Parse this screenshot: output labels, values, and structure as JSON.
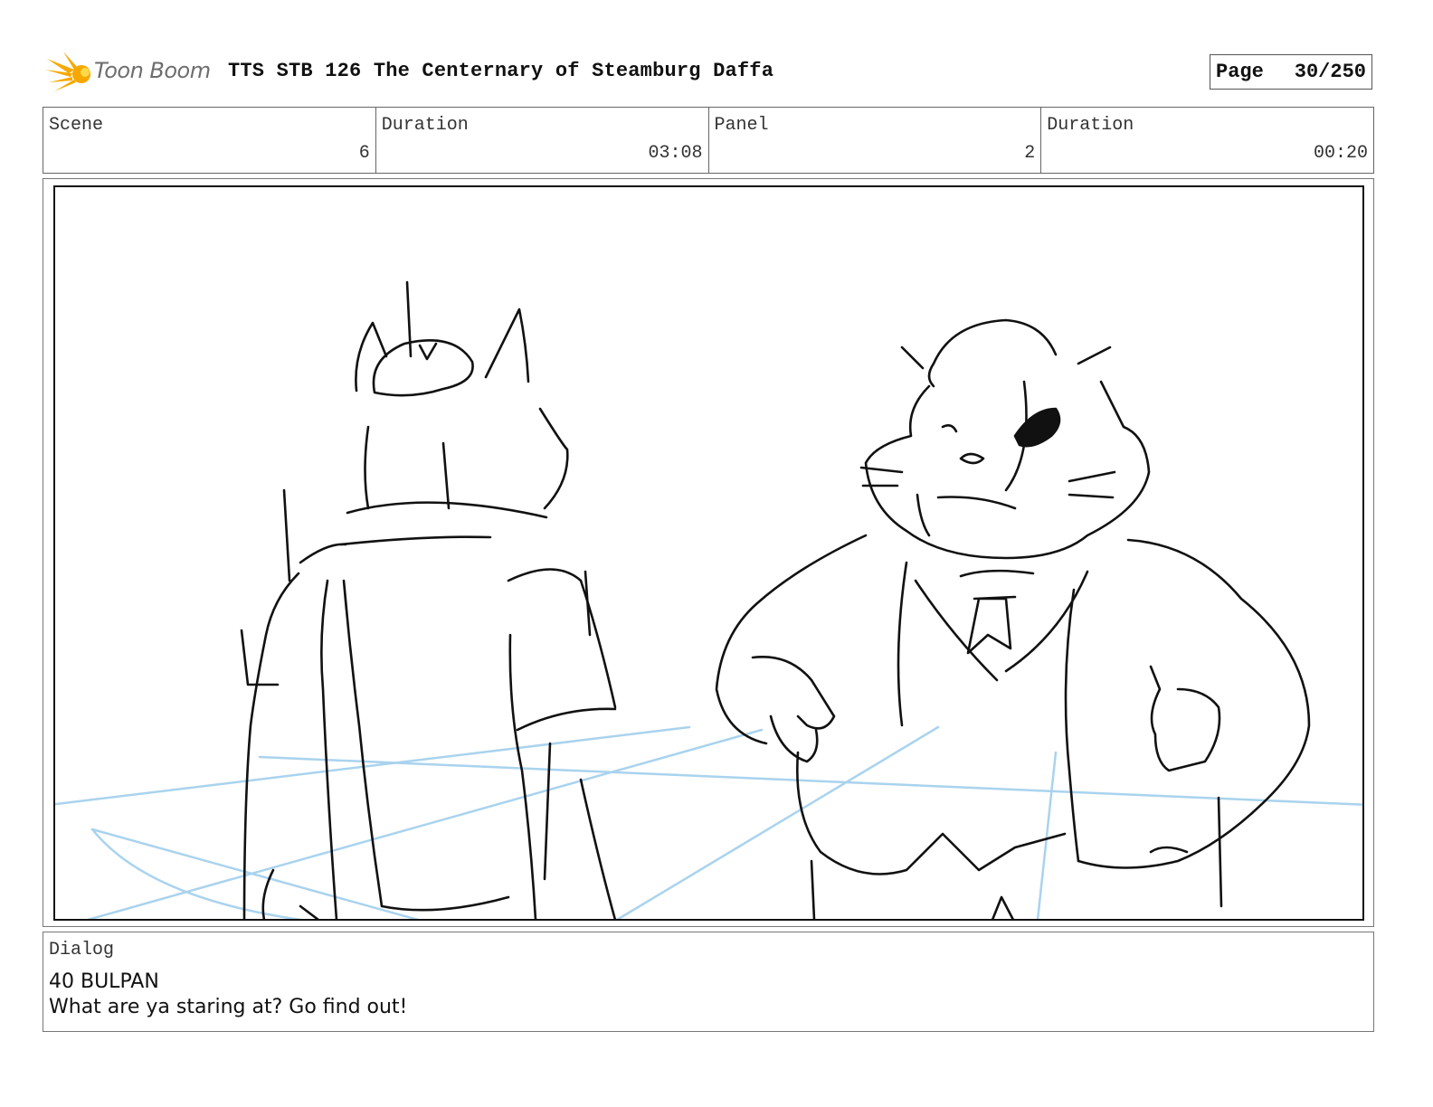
{
  "header": {
    "logo_text": "Toon Boom",
    "title": "TTS STB 126 The Centernary of Steamburg Daffa",
    "page_label": "Page",
    "page_value": "30/250"
  },
  "info": {
    "scene_label": "Scene",
    "scene_value": "6",
    "scene_duration_label": "Duration",
    "scene_duration_value": "03:08",
    "panel_label": "Panel",
    "panel_value": "2",
    "panel_duration_label": "Duration",
    "panel_duration_value": "00:20"
  },
  "dialog": {
    "label": "Dialog",
    "line1": "40 BULPAN",
    "line2": "What are ya staring at? Go find out!"
  },
  "colors": {
    "logo_orange": "#f6a800",
    "guide_blue": "#a9d3ee",
    "sketch": "#111111"
  }
}
